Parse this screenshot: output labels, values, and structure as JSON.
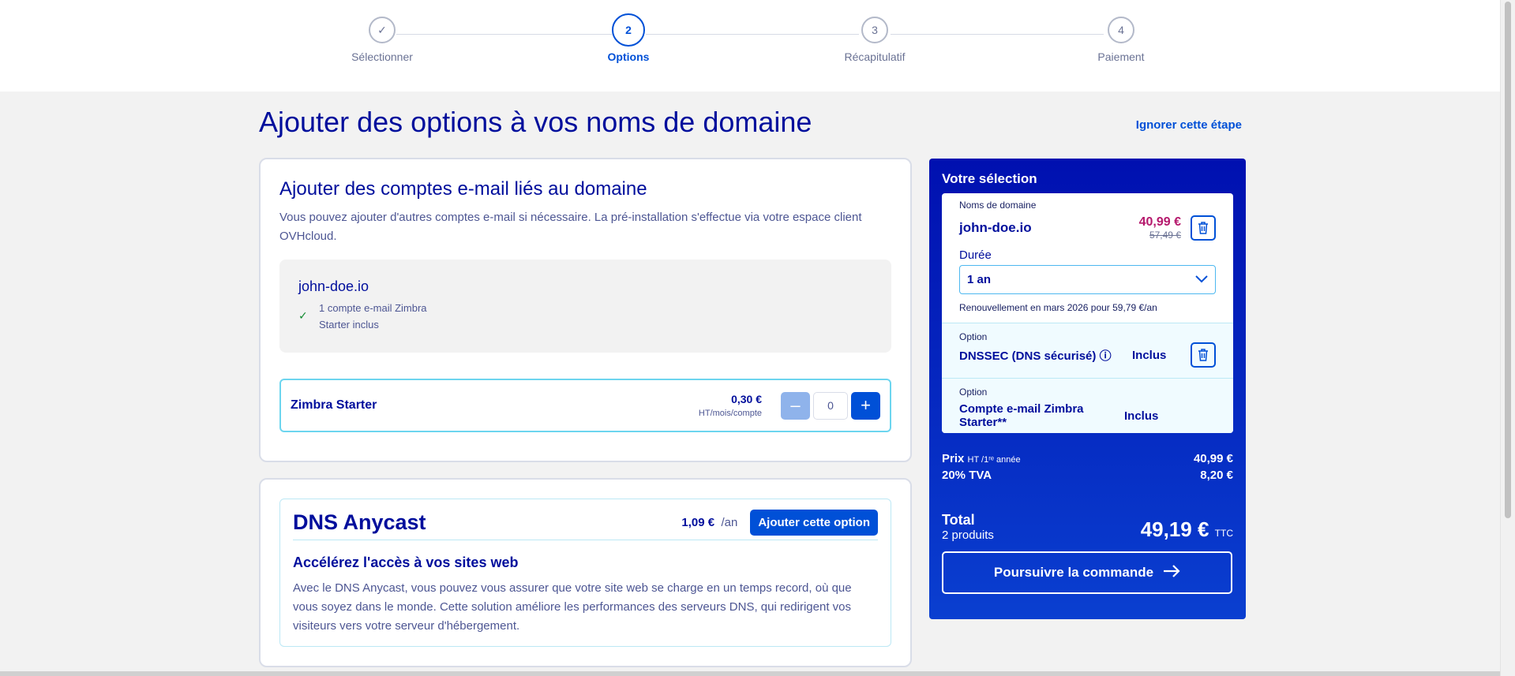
{
  "stepper": {
    "steps": [
      {
        "label": "Sélectionner",
        "marker": "✓"
      },
      {
        "label": "Options",
        "marker": "2"
      },
      {
        "label": "Récapitulatif",
        "marker": "3"
      },
      {
        "label": "Paiement",
        "marker": "4"
      }
    ]
  },
  "page": {
    "title": "Ajouter des options à vos noms de domaine",
    "skip": "Ignorer cette étape"
  },
  "email_card": {
    "title": "Ajouter des comptes e-mail liés au domaine",
    "desc": "Vous pouvez ajouter d'autres comptes e-mail si nécessaire. La pré-installation s'effectue via votre espace client OVHcloud.",
    "domain": "john-doe.io",
    "included_line1": "1 compte e-mail Zimbra",
    "included_line2": "Starter inclus",
    "product": "Zimbra Starter",
    "price": "0,30 €",
    "price_unit": "HT/mois/compte",
    "qty": "0",
    "minus": "–",
    "plus": "+"
  },
  "dns_card": {
    "title": "DNS Anycast",
    "price": "1,09 €",
    "period": "/an",
    "button": "Ajouter cette option",
    "subtitle": "Accélérez l'accès à vos sites web",
    "desc": "Avec le DNS Anycast, vous pouvez vous assurer que votre site web se charge en un temps record, où que vous soyez dans le monde. Cette solution améliore les performances des serveurs DNS, qui redirigent vos visiteurs vers votre serveur d'hébergement."
  },
  "summary": {
    "title": "Votre sélection",
    "domain_label": "Noms de domaine",
    "domain": "john-doe.io",
    "price_new": "40,99 €",
    "price_old": "57,49 €",
    "duree_label": "Durée",
    "duree_value": "1 an",
    "renew": "Renouvellement en mars 2026 pour 59,79 €/an",
    "option1_label": "Option",
    "option1_name": "DNSSEC (DNS sécurisé)",
    "option1_status": "Inclus",
    "option2_label": "Option",
    "option2_name": "Compte e-mail Zimbra Starter**",
    "option2_status": "Inclus",
    "prix_label": "Prix",
    "prix_suffix": "HT /1ʳᵉ année",
    "prix_value": "40,99 €",
    "tva_label": "20% TVA",
    "tva_value": "8,20 €",
    "total_label": "Total",
    "total_sub": "2 produits",
    "total_value": "49,19 €",
    "total_suffix": "TTC",
    "cta": "Poursuivre la commande"
  },
  "colors": {
    "brand": "#0050d7",
    "navy": "#000e9c",
    "sidebar_top": "#0010b0",
    "price_accent": "#b5186c"
  }
}
